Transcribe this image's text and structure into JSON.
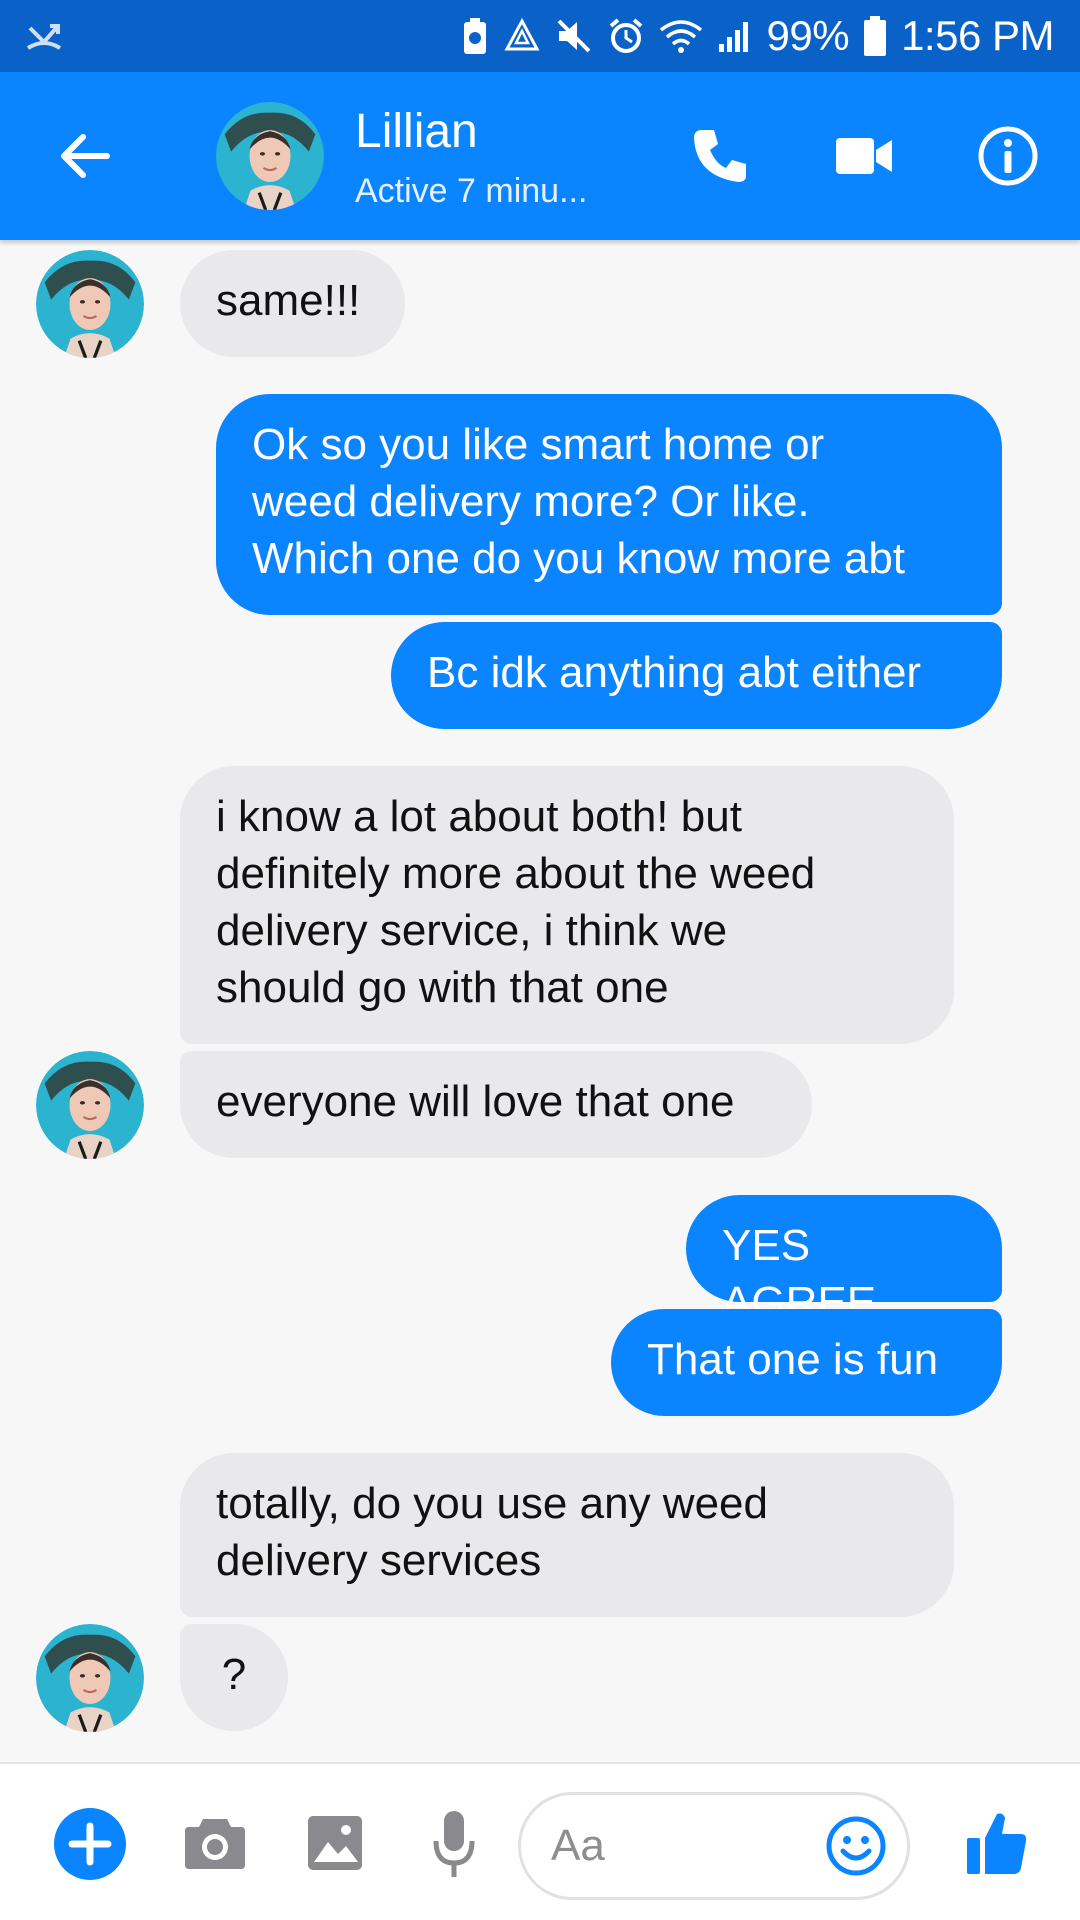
{
  "status_bar": {
    "battery_percent": "99%",
    "time": "1:56 PM",
    "icons": [
      "missed-call-icon",
      "storage-cleaner-icon",
      "recycle-icon",
      "mute-icon",
      "alarm-icon",
      "wifi-icon",
      "signal-icon",
      "battery-icon"
    ]
  },
  "header": {
    "contact_name": "Lillian",
    "contact_status": "Active 7 minu...",
    "accent_color": "#0a84ff",
    "icons": [
      "back-arrow-icon",
      "phone-icon",
      "video-camera-icon",
      "info-icon"
    ]
  },
  "messages": [
    {
      "sender": "Lillian",
      "direction": "incoming",
      "text": "same!!!"
    },
    {
      "sender": "me",
      "direction": "outgoing",
      "text": "Ok so you like smart home or\nweed delivery more? Or like.\nWhich one do you know more abt"
    },
    {
      "sender": "me",
      "direction": "outgoing",
      "text": "Bc idk anything abt either"
    },
    {
      "sender": "Lillian",
      "direction": "incoming",
      "text": "i know a lot about both! but\ndefinitely more about the weed\ndelivery service, i think we\nshould go with that one"
    },
    {
      "sender": "Lillian",
      "direction": "incoming",
      "text": "everyone will love that one"
    },
    {
      "sender": "me",
      "direction": "outgoing",
      "text": "YES AGREE"
    },
    {
      "sender": "me",
      "direction": "outgoing",
      "text": "That one is fun"
    },
    {
      "sender": "Lillian",
      "direction": "incoming",
      "text": "totally, do you use any weed\ndelivery services"
    },
    {
      "sender": "Lillian",
      "direction": "incoming",
      "text": "?"
    }
  ],
  "composer": {
    "placeholder": "Aa",
    "value": "",
    "icons": [
      "plus-icon",
      "camera-icon",
      "gallery-icon",
      "microphone-icon",
      "emoji-icon",
      "thumbs-up-icon"
    ]
  },
  "colors": {
    "status_bar": "#0a62c8",
    "header": "#0a84ff",
    "outgoing_bubble": "#0a84ff",
    "incoming_bubble": "#e9e9eb",
    "background": "#f7f7f8"
  }
}
